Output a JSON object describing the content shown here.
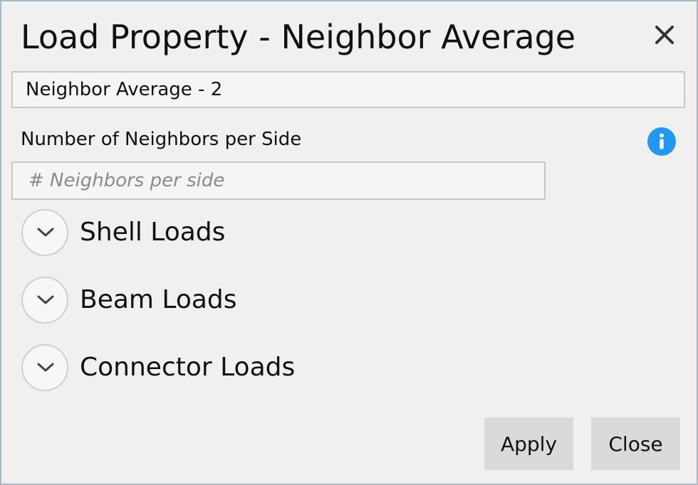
{
  "dialog": {
    "title": "Load Property - Neighbor Average",
    "close_icon": "close-icon"
  },
  "name_field": {
    "value": "Neighbor Average - 2"
  },
  "neighbors": {
    "label": "Number of Neighbors per Side",
    "placeholder": "# Neighbors per side",
    "value": "",
    "info_icon": "info-icon"
  },
  "sections": [
    {
      "label": "Shell Loads",
      "icon": "chevron-down-icon",
      "expanded": false
    },
    {
      "label": "Beam Loads",
      "icon": "chevron-down-icon",
      "expanded": false
    },
    {
      "label": "Connector Loads",
      "icon": "chevron-down-icon",
      "expanded": false
    }
  ],
  "buttons": {
    "apply_label": "Apply",
    "close_label": "Close"
  },
  "colors": {
    "background": "#f0f0f0",
    "border": "#a9b8c8",
    "info_blue": "#2196f3",
    "button_bg": "#dadada"
  }
}
